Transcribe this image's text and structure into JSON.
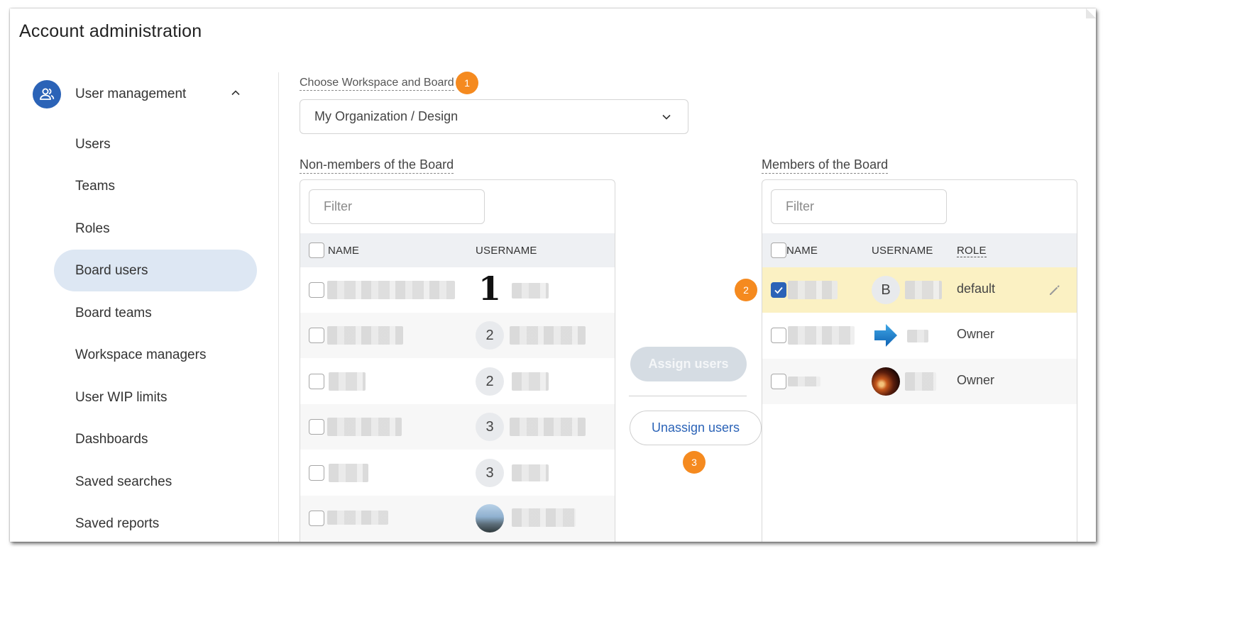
{
  "window": {
    "title": "Account administration"
  },
  "sidebar": {
    "section": {
      "label": "User management",
      "icon": "users-icon",
      "expanded": true
    },
    "items": [
      {
        "label": "Users",
        "active": false
      },
      {
        "label": "Teams",
        "active": false
      },
      {
        "label": "Roles",
        "active": false
      },
      {
        "label": "Board users",
        "active": true
      },
      {
        "label": "Board teams",
        "active": false
      },
      {
        "label": "Workspace managers",
        "active": false
      },
      {
        "label": "User WIP limits",
        "active": false
      },
      {
        "label": "Dashboards",
        "active": false
      },
      {
        "label": "Saved searches",
        "active": false
      },
      {
        "label": "Saved reports",
        "active": false
      }
    ]
  },
  "main": {
    "workspace_label": "Choose Workspace and Board",
    "workspace_value": "My Organization / Design",
    "badges": {
      "one": "1",
      "two": "2",
      "three": "3"
    },
    "non_members": {
      "title": "Non-members of the Board",
      "filter_placeholder": "Filter",
      "columns": {
        "name": "NAME",
        "username": "USERNAME"
      },
      "rows": [
        {
          "avatar": "1",
          "avatar_style": "big-one"
        },
        {
          "avatar": "2",
          "avatar_style": "initial"
        },
        {
          "avatar": "2",
          "avatar_style": "initial"
        },
        {
          "avatar": "3",
          "avatar_style": "initial"
        },
        {
          "avatar": "3",
          "avatar_style": "initial"
        },
        {
          "avatar": "",
          "avatar_style": "photo"
        }
      ]
    },
    "actions": {
      "assign": "Assign users",
      "unassign": "Unassign users"
    },
    "members": {
      "title": "Members of the Board",
      "filter_placeholder": "Filter",
      "columns": {
        "name": "NAME",
        "username": "USERNAME",
        "role": "ROLE"
      },
      "rows": [
        {
          "avatar": "B",
          "avatar_style": "initial",
          "role": "default",
          "checked": true
        },
        {
          "avatar": "",
          "avatar_style": "arrow",
          "role": "Owner",
          "checked": false
        },
        {
          "avatar": "",
          "avatar_style": "photo",
          "role": "Owner",
          "checked": false
        }
      ]
    }
  },
  "colors": {
    "accent": "#2b63b7",
    "badge": "#f58a1f",
    "selected_row": "#fbf1c3",
    "active_nav": "#dde7f3"
  }
}
